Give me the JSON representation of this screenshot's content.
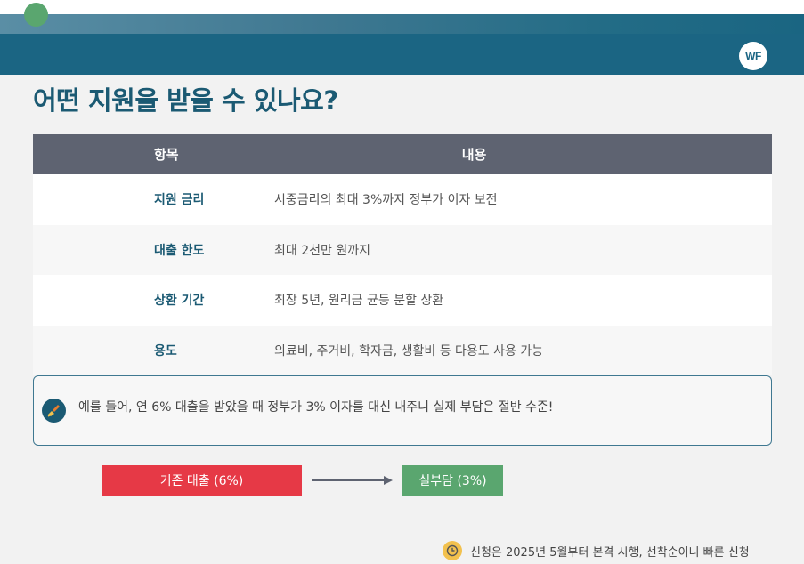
{
  "header": {
    "logo_text": "WF"
  },
  "page": {
    "title": "어떤 지원을 받을 수 있나요?"
  },
  "table": {
    "headers": {
      "item": "항목",
      "content": "내용"
    },
    "rows": [
      {
        "item": "지원 금리",
        "content": "시중금리의 최대 3%까지 정부가 이자 보전"
      },
      {
        "item": "대출 한도",
        "content": "최대 2천만 원까지"
      },
      {
        "item": "상환 기간",
        "content": "최장 5년, 원리금 균등 분할 상환"
      },
      {
        "item": "용도",
        "content": "의료비, 주거비, 학자금, 생활비 등 다용도 사용 가능"
      }
    ]
  },
  "example": {
    "icon": "writing-hand-icon",
    "text": "예를 들어, 연 6% 대출을 받았을 때 정부가 3% 이자를 대신 내주니 실제 부담은 절반 수준!"
  },
  "flow": {
    "from_label": "기존 대출 (6%)",
    "to_label": "실부담 (3%)",
    "arrow_icon": "arrow-right-icon"
  },
  "footer": {
    "icon": "clock-icon",
    "text": "신청은 2025년 5월부터 본격 시행, 선착순이니 빠른 신청"
  },
  "colors": {
    "primary": "#1b6583",
    "title": "#1b5a73",
    "table_header": "#5e6371",
    "accent_red": "#e63946",
    "accent_green": "#5aa66f",
    "accent_yellow": "#f2c14e"
  }
}
